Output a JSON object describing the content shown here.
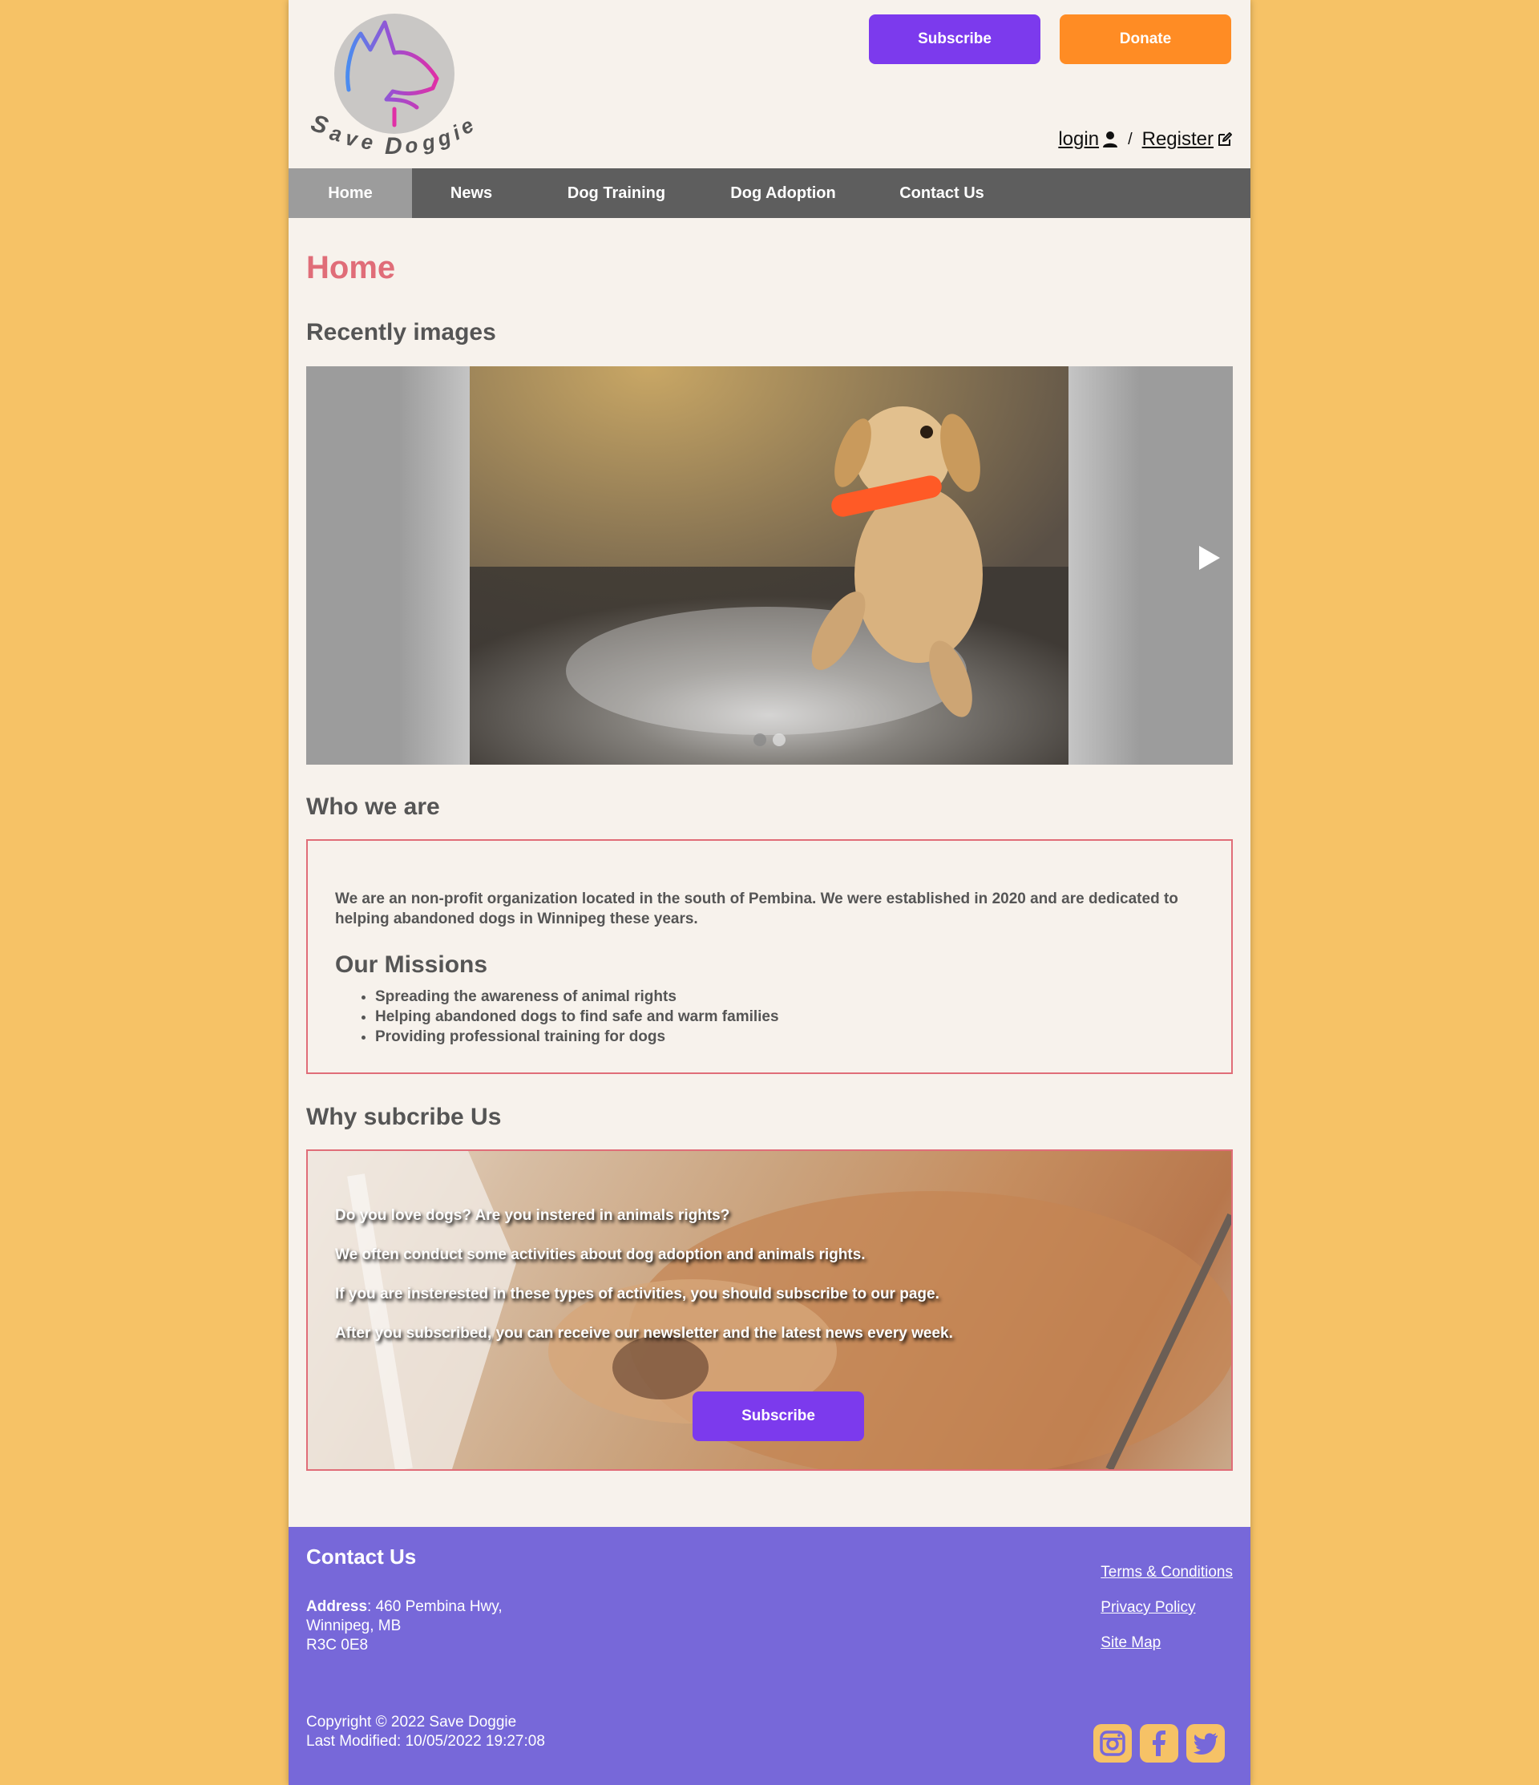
{
  "brand": {
    "name": "Save Doggie"
  },
  "header": {
    "subscribe_label": "Subscribe",
    "donate_label": "Donate",
    "login_label": "login",
    "separator": "/",
    "register_label": "Register"
  },
  "nav": {
    "items": [
      {
        "label": "Home",
        "active": true
      },
      {
        "label": "News"
      },
      {
        "label": "Dog Training"
      },
      {
        "label": "Dog Adoption"
      },
      {
        "label": "Contact Us"
      }
    ]
  },
  "main": {
    "title": "Home",
    "recent_heading": "Recently images",
    "carousel": {
      "slides": 2,
      "active_slide": 1
    },
    "who_heading": "Who we are",
    "who_text": "We are an non-profit organization located in the south of Pembina. We were established in 2020 and are dedicated to helping abandoned dogs in Winnipeg these years.",
    "missions_heading": "Our Missions",
    "missions": [
      "Spreading the awareness of animal rights",
      "Helping abandoned dogs to find safe and warm families",
      "Providing professional training for dogs"
    ],
    "why_heading": "Why subcribe Us",
    "why_lines": [
      "Do you love dogs? Are you instered in animals rights?",
      "We often conduct some activities about dog adoption and animals rights.",
      "If you are insterested in these types of activities, you should subscribe to our page.",
      "After you subscribed, you can receive our newsletter and the latest news every week."
    ],
    "why_subscribe_label": "Subscribe"
  },
  "footer": {
    "heading": "Contact Us",
    "address_label": "Address",
    "address_line1": ": 460 Pembina Hwy,",
    "address_line2": "Winnipeg, MB",
    "address_line3": "R3C 0E8",
    "copyright": "Copyright © 2022 Save Doggie",
    "last_modified": "Last Modified: 10/05/2022 19:27:08",
    "links": [
      "Terms & Conditions",
      "Privacy Policy",
      "Site Map"
    ],
    "social": [
      "instagram-icon",
      "facebook-icon",
      "twitter-icon"
    ]
  },
  "colors": {
    "background": "#f6c266",
    "subscribe": "#7c3aed",
    "donate": "#ff8c24",
    "accent": "#e06d78",
    "footer": "#7768d9",
    "nav": "#5e5e5e"
  }
}
